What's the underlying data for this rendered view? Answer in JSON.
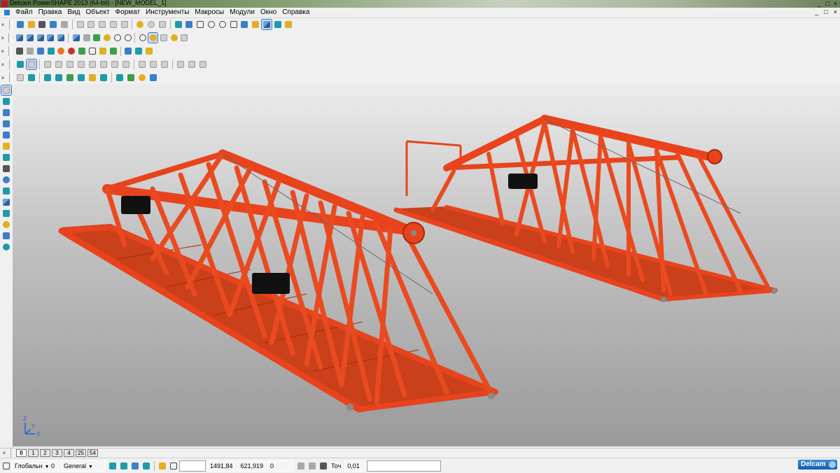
{
  "window": {
    "title": "Delcam PowerSHAPE 2013 (64-bit) - [NEW_MODEL_1]",
    "controls": [
      "_",
      "□",
      "×"
    ]
  },
  "menu": {
    "items": [
      "Файл",
      "Правка",
      "Вид",
      "Объект",
      "Формат",
      "Инструменты",
      "Макросы",
      "Модули",
      "Окно",
      "Справка"
    ],
    "mdi_controls": [
      "_",
      "□",
      "×"
    ]
  },
  "toolbars": {
    "row1": [
      "new-icon",
      "open-icon",
      "save-icon",
      "save-as-icon",
      "print-icon",
      "cut-icon",
      "copy-icon",
      "paste-icon",
      "measure-icon",
      "delete-icon",
      "undo-icon",
      "redo-icon",
      "dimension-icon",
      "select-by-type-icon",
      "workplane-icon",
      "line-icon",
      "arc-icon",
      "circle-icon",
      "curve-icon",
      "text-icon",
      "edit-icon",
      "shaded-icon",
      "group-icon",
      "wizard-icon"
    ],
    "row2": [
      "sheet-icon",
      "calc-icon",
      "doc-icon",
      "plane-icon",
      "sphere-icon",
      "ball-icon",
      "triangle-icon",
      "box-icon",
      "surface-icon",
      "cube-icon",
      "macro-icon"
    ],
    "row3": [
      "select-icon",
      "window-icon",
      "view-iso-icon",
      "view-top-icon",
      "view-front-icon",
      "view-side-icon",
      "view-back-icon",
      "view-left-icon",
      "view-bottom-icon",
      "view-right-icon",
      "fit-icon",
      "zoom-icon",
      "pan-icon",
      "rotate-icon",
      "wireframe-icon",
      "render-icon"
    ],
    "row4": [
      "shade-icon",
      "axis-icon",
      "solid-icon",
      "surface-ops-icon",
      "blend-icon",
      "fillet-icon",
      "chamfer-icon",
      "shell-icon",
      "boolean-icon",
      "mesh-icon",
      "layer-icon",
      "lighting-icon"
    ]
  },
  "left_toolbar": [
    "pointer-icon",
    "select-icon",
    "copy-icon",
    "mirror-icon",
    "group-icon",
    "scale-icon",
    "extrude-icon",
    "revolve-icon",
    "solid-icon",
    "table-icon",
    "cube-icon",
    "block-icon",
    "ball-icon",
    "shape-icon",
    "globe-icon"
  ],
  "viewport": {
    "axis_x": "X",
    "axis_y": "Y",
    "axis_z": "Z",
    "colors": {
      "truss": "#e8431c",
      "truss_dark": "#a82808",
      "counterweight": "#111111",
      "joint": "#8a8a8a"
    }
  },
  "view_tabs": [
    "0",
    "1",
    "2",
    "3",
    "4",
    "25",
    "54"
  ],
  "status": {
    "workplane_label": "Глобальн",
    "level_number": "0",
    "level_name": "General",
    "coord_x": "1491,84",
    "coord_y": "621,919",
    "coord_z": "0",
    "tolerance_label": "Точ",
    "tolerance_value": "0,01",
    "brand": "Delcam"
  }
}
